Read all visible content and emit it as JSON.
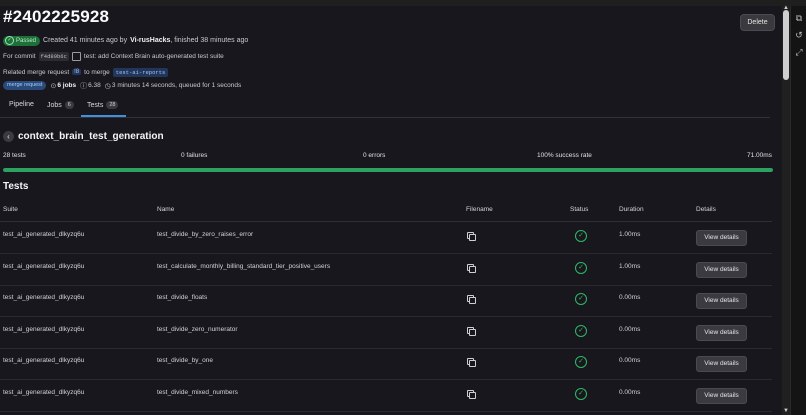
{
  "pipeline": {
    "title": "#2402225928",
    "delete_label": "Delete",
    "status_badge": "Passed",
    "created_text": "Created 41 minutes ago by",
    "author": "Vi-rusHacks",
    "finished_text": ", finished 38 minutes ago",
    "for_commit_label": "For commit",
    "commit_sha": "f4d89b6c",
    "commit_message": "test: add Context Brain auto-generated test suite",
    "related_mr_label": "Related merge request",
    "mr_ref": "!8",
    "to_merge_label": "to merge",
    "branch": "test-ai-reports",
    "mr_badge": "merge request",
    "jobs_count": "6 jobs",
    "coverage": "6.38",
    "duration": "3 minutes 14 seconds, queued for 1 seconds"
  },
  "tabs": [
    {
      "label": "Pipeline"
    },
    {
      "label": "Jobs",
      "count": "6"
    },
    {
      "label": "Tests",
      "count": "28"
    }
  ],
  "suite": {
    "name": "context_brain_test_generation",
    "tests": "28 tests",
    "failures": "0 failures",
    "errors": "0 errors",
    "success_rate": "100% success rate",
    "time": "71.00ms",
    "success_fraction": 1.0
  },
  "tests_section": {
    "heading": "Tests",
    "columns": [
      "Suite",
      "Name",
      "Filename",
      "Status",
      "Duration",
      "Details"
    ],
    "view_details_label": "View details",
    "rows": [
      {
        "suite": "test_ai_generated_dlkyzq6u",
        "name": "test_divide_by_zero_raises_error",
        "duration": "1.00ms"
      },
      {
        "suite": "test_ai_generated_dlkyzq6u",
        "name": "test_calculate_monthly_billing_standard_tier_positive_users",
        "duration": "1.00ms"
      },
      {
        "suite": "test_ai_generated_dlkyzq6u",
        "name": "test_divide_floats",
        "duration": "0.00ms"
      },
      {
        "suite": "test_ai_generated_dlkyzq6u",
        "name": "test_divide_zero_numerator",
        "duration": "0.00ms"
      },
      {
        "suite": "test_ai_generated_dlkyzq6u",
        "name": "test_divide_by_one",
        "duration": "0.00ms"
      },
      {
        "suite": "test_ai_generated_dlkyzq6u",
        "name": "test_divide_mixed_numbers",
        "duration": "0.00ms"
      }
    ]
  },
  "icons": {
    "status": "check-circle-icon",
    "filename": "copy-icon",
    "back": "chevron-left-icon",
    "jobs": "pipeline-icon",
    "coverage": "coverage-icon",
    "duration": "clock-icon"
  },
  "colors": {
    "success": "#2da160",
    "accent": "#428fdc"
  }
}
